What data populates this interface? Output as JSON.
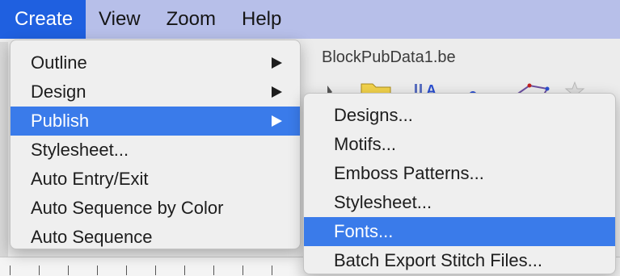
{
  "menubar": {
    "items": [
      {
        "label": "Create",
        "active": true
      },
      {
        "label": "View"
      },
      {
        "label": "Zoom"
      },
      {
        "label": "Help"
      }
    ]
  },
  "window": {
    "document_title": "BlockPubData1.be"
  },
  "create_menu": {
    "items": [
      {
        "label": "Outline",
        "has_submenu": true
      },
      {
        "label": "Design",
        "has_submenu": true
      },
      {
        "label": "Publish",
        "has_submenu": true,
        "highlighted": true
      },
      {
        "label": "Stylesheet..."
      },
      {
        "label": "Auto Entry/Exit"
      },
      {
        "label": "Auto Sequence by Color"
      },
      {
        "label": "Auto Sequence"
      }
    ]
  },
  "publish_submenu": {
    "items": [
      {
        "label": "Designs..."
      },
      {
        "label": "Motifs..."
      },
      {
        "label": "Emboss Patterns..."
      },
      {
        "label": "Stylesheet..."
      },
      {
        "label": "Fonts...",
        "highlighted": true
      },
      {
        "label": "Batch Export Stitch Files..."
      }
    ]
  },
  "colors": {
    "menubar_bg": "#b7bfe9",
    "active_menu": "#1f60e0",
    "highlight": "#3a7bea"
  },
  "icons": [
    "submenu-arrow-icon",
    "pointer-tool-icon",
    "folder-icon",
    "text-tool-icon",
    "line-tool-icon",
    "shape-tool-icon",
    "star-tool-icon"
  ]
}
